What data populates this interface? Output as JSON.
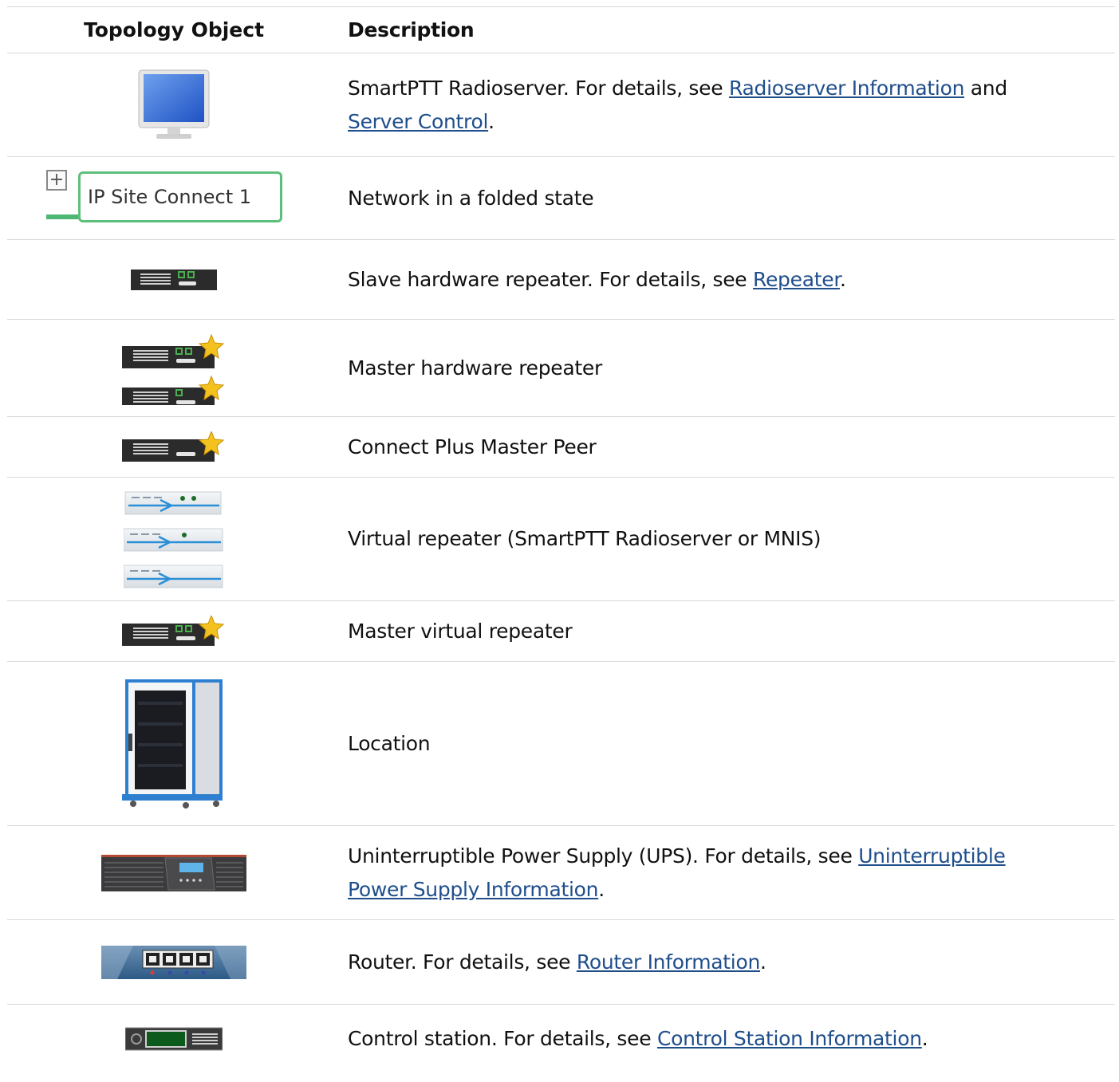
{
  "header": {
    "col1": "Topology Object",
    "col2": "Description"
  },
  "rows": [
    {
      "icon": "monitor-icon",
      "parts": [
        "SmartPTT Radioserver. For details, see ",
        "Radioserver Information",
        " and ",
        "Server Control",
        "."
      ]
    },
    {
      "icon": "folded-network-icon",
      "label": "IP Site Connect 1",
      "plus": "+",
      "parts": [
        "Network in a folded state"
      ]
    },
    {
      "icon": "slave-repeater-icon",
      "parts": [
        "Slave hardware repeater. For details, see ",
        "Repeater",
        "."
      ]
    },
    {
      "icon": "master-repeater-icon",
      "parts": [
        "Master hardware repeater"
      ]
    },
    {
      "icon": "connect-plus-master-peer-icon",
      "parts": [
        "Connect Plus Master Peer"
      ]
    },
    {
      "icon": "virtual-repeater-icon",
      "parts": [
        "Virtual repeater (SmartPTT Radioserver or MNIS)"
      ]
    },
    {
      "icon": "master-virtual-repeater-icon",
      "parts": [
        "Master virtual repeater"
      ]
    },
    {
      "icon": "location-cabinet-icon",
      "parts": [
        "Location"
      ]
    },
    {
      "icon": "ups-icon",
      "parts": [
        "Uninterruptible Power Supply (UPS). For details, see ",
        "Uninterruptible Power Supply Information",
        "."
      ]
    },
    {
      "icon": "router-icon",
      "parts": [
        "Router. For details, see ",
        "Router Information",
        "."
      ]
    },
    {
      "icon": "control-station-icon",
      "parts": [
        "Control station. For details, see ",
        "Control Station Information",
        "."
      ]
    }
  ]
}
